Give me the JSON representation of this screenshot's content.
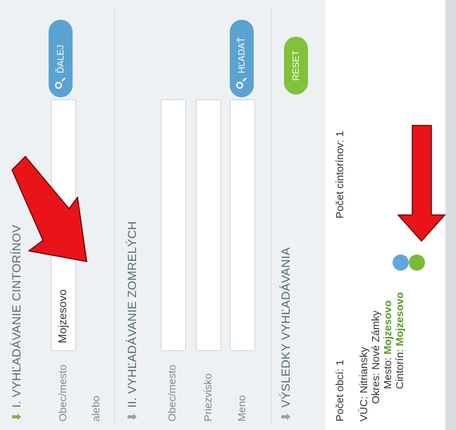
{
  "search_cemeteries": {
    "title": "I. VYHĽADÁVANIE CINTORÍNOV",
    "city_label": "Obec/mesto",
    "city_value": "Mojzesovo",
    "or_label": "alebo",
    "next_button": "ĎALEJ"
  },
  "search_deceased": {
    "title": "II. VYHĽADÁVANIE ZOMRELÝCH",
    "city_label": "Obec/mesto",
    "surname_label": "Priezvisko",
    "name_label": "Meno",
    "search_button": "HĽADAŤ"
  },
  "results": {
    "title": "VÝSLEDKY VYHĽADÁVANIA",
    "reset_button": "RESET",
    "municipality_count": "Počet obcí: 1",
    "cemetery_count": "Počet cintorínov: 1",
    "region": "VÚC: Nitriansky",
    "district": "Okres: Nové Zámky",
    "town_label": "Mesto:",
    "town_value": "Mojzesovo",
    "cemetery_label": "Cintorín:",
    "cemetery_value": "Mojzesovo"
  },
  "colors": {
    "accent_green": "#82c13a",
    "accent_blue": "#5aa3d0",
    "arrow_red": "#e8141a",
    "dot_blue": "#62a7df",
    "dot_green": "#7db937"
  }
}
